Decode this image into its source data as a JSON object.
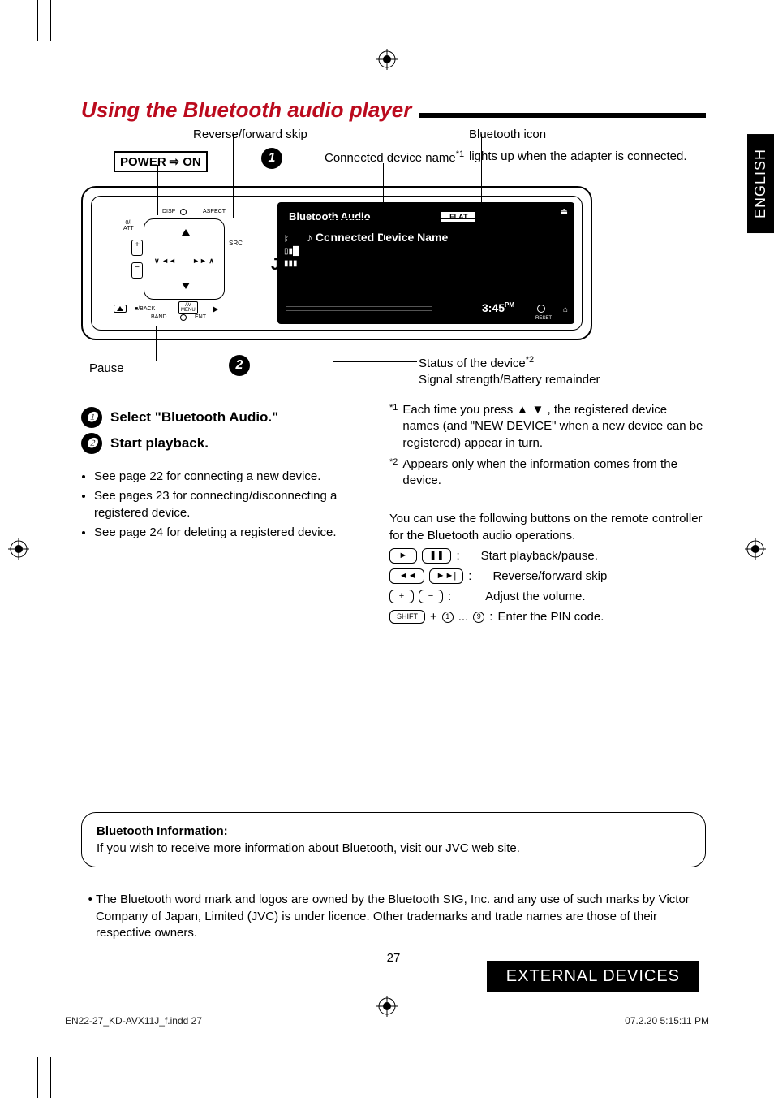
{
  "sideTab": "ENGLISH",
  "heading": "Using the Bluetooth audio player",
  "topLabels": {
    "revfwd": "Reverse/forward skip",
    "btIcon": "Bluetooth icon",
    "btIconSub": "lights up when the adapter is connected.",
    "connDev": "Connected device name",
    "power": "POWER",
    "on": "ON"
  },
  "badges": {
    "b1": "1",
    "b2": "2"
  },
  "lcd": {
    "mode": "Bluetooth Audio",
    "eq": "FLAT",
    "devName": "Connected Device Name",
    "time": "3:45",
    "pm": "PM",
    "reset": "RESET"
  },
  "deviceTiny": {
    "jvc": "JVC",
    "disp": "DISP",
    "aspect": "ASPECT",
    "att": "0/I\nATT",
    "avmenu": "AV\nMENU",
    "src": "SRC",
    "back": "■/BACK",
    "band": "BAND",
    "ent": "ENT",
    "left": "∨ ◄◄",
    "right": "►► ∧",
    "plus": "+",
    "minus": "−"
  },
  "belowDevice": {
    "pause": "Pause",
    "status": "Status of the device",
    "signal": "Signal strength/Battery remainder"
  },
  "steps": {
    "s1": "Select \"Bluetooth Audio.\"",
    "s2": "Start playback."
  },
  "leftBullets": [
    "See page 22 for connecting a new device.",
    "See pages 23 for connecting/disconnecting a registered device.",
    "See page 24 for deleting a registered device."
  ],
  "footnotes": {
    "f1pre": "Each time you press ",
    "f1post": ", the registered device names (and \"NEW DEVICE\" when a new device can be registered) appear in turn.",
    "f2": "Appears only when the information comes from the device."
  },
  "remote": {
    "intro": "You can use the following buttons on the remote controller for the Bluetooth audio operations.",
    "r1": "Start playback/pause.",
    "r2": "Reverse/forward skip",
    "r3": "Adjust the volume.",
    "r4": "Enter the PIN code.",
    "btn_play": "►",
    "btn_pause": "❚❚",
    "btn_prev": "|◄◄",
    "btn_next": "►►|",
    "btn_plus": "+",
    "btn_minus": "−",
    "btn_shift": "SHIFT",
    "n1": "1",
    "n9": "9"
  },
  "infoBox": {
    "title": "Bluetooth Information:",
    "body": "If you wish to receive more information about Bluetooth, visit our JVC web site."
  },
  "trademark": "The Bluetooth word mark and logos are owned by the Bluetooth SIG, Inc. and any use of such marks by Victor Company of Japan, Limited (JVC) is under licence. Other trademarks and trade names are those of their respective owners.",
  "pageNum": "27",
  "footerBar": "EXTERNAL DEVICES",
  "printFoot": {
    "left": "EN22-27_KD-AVX11J_f.indd   27",
    "right": "07.2.20   5:15:11 PM"
  },
  "sup1": "*1",
  "sup2": "*2",
  "starGlyph": "*",
  "arrowUp": "▲",
  "arrowDown": "▼",
  "arrowBiDir": "⇨",
  "dots": "...",
  "plus": "+",
  "colon": ":",
  "colonSp": " : ",
  "noteIcon": "♪"
}
